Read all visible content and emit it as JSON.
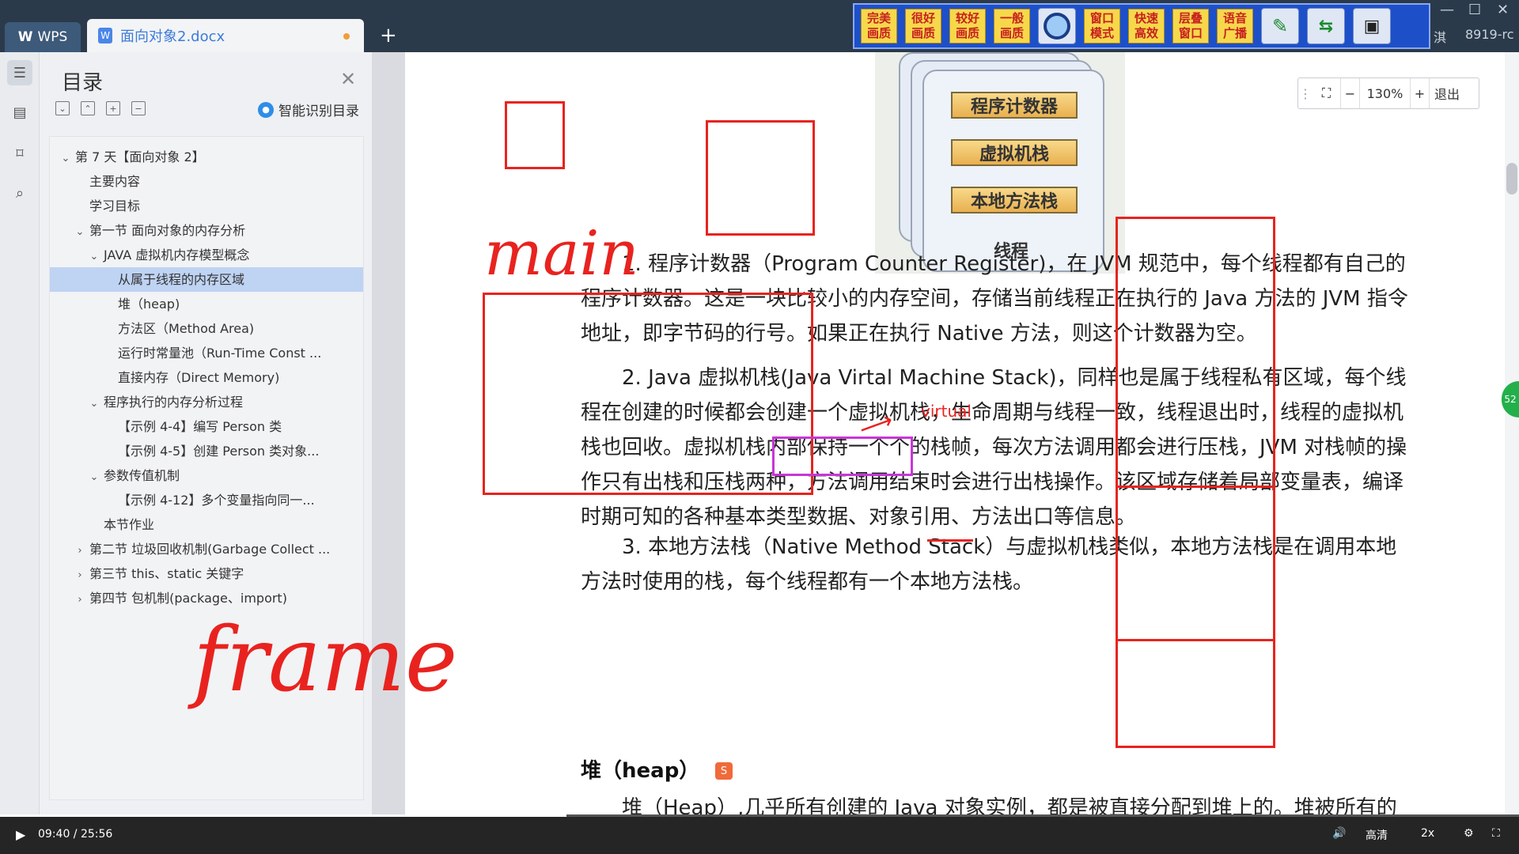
{
  "titlebar": {
    "wps_label": "WPS",
    "doc_tab_title": "面向对象2.docx",
    "new_tab_symbol": "+",
    "right_title": "8919-rc",
    "right_title_prefix": "淇"
  },
  "yellow_toolbar": {
    "buttons": [
      "完美画质",
      "很好画质",
      "较好画质",
      "一般画质",
      "窗口模式",
      "快速高效",
      "层叠窗口",
      "语音广播"
    ]
  },
  "toc": {
    "title": "目录",
    "smart_label": "智能识别目录",
    "items": [
      {
        "label": "第 7 天【面向对象 2】",
        "level": 0,
        "chevron": "v"
      },
      {
        "label": "主要内容",
        "level": 1,
        "chevron": ""
      },
      {
        "label": "学习目标",
        "level": 1,
        "chevron": ""
      },
      {
        "label": "第一节  面向对象的内存分析",
        "level": 1,
        "chevron": "v"
      },
      {
        "label": "JAVA 虚拟机内存模型概念",
        "level": 2,
        "chevron": "v"
      },
      {
        "label": "从属于线程的内存区域",
        "level": 3,
        "chevron": "",
        "selected": true
      },
      {
        "label": "堆（heap)",
        "level": 3,
        "chevron": ""
      },
      {
        "label": "方法区（Method Area)",
        "level": 3,
        "chevron": ""
      },
      {
        "label": "运行时常量池（Run-Time Const ...",
        "level": 3,
        "chevron": ""
      },
      {
        "label": "直接内存（Direct Memory)",
        "level": 3,
        "chevron": ""
      },
      {
        "label": "程序执行的内存分析过程",
        "level": 2,
        "chevron": "v"
      },
      {
        "label": "【示例 4-4】编写 Person 类",
        "level": 3,
        "chevron": ""
      },
      {
        "label": "【示例 4-5】创建 Person 类对象...",
        "level": 3,
        "chevron": ""
      },
      {
        "label": "参数传值机制",
        "level": 2,
        "chevron": "v"
      },
      {
        "label": "【示例 4-12】多个变量指向同一...",
        "level": 3,
        "chevron": ""
      },
      {
        "label": "本节作业",
        "level": 2,
        "chevron": ""
      },
      {
        "label": "第二节  垃圾回收机制(Garbage Collect ...",
        "level": 1,
        "chevron": ">"
      },
      {
        "label": "第三节  this、static 关键字",
        "level": 1,
        "chevron": ">"
      },
      {
        "label": "第四节  包机制(package、import)",
        "level": 1,
        "chevron": ">"
      }
    ]
  },
  "figure": {
    "labels": [
      "程序计数器",
      "虚拟机栈",
      "本地方法栈"
    ],
    "thread_label": "线程"
  },
  "zoom": {
    "value": "130%",
    "exit_label": "退出",
    "minus": "−",
    "plus": "+"
  },
  "document": {
    "para1": "1. 程序计数器（Program Counter Register)，在 JVM 规范中，每个线程都有自己的程序计数器。这是一块比较小的内存空间，存储当前线程正在执行的 Java 方法的 JVM 指令地址，即字节码的行号。如果正在执行 Native 方法，则这个计数器为空。",
    "para2": "2. Java 虚拟机栈(Java Virtal Machine Stack)，同样也是属于线程私有区域，每个线程在创建的时候都会创建一个虚拟机栈，生命周期与线程一致，线程退出时，线程的虚拟机栈也回收。虚拟机栈内部保持一个个的栈帧，每次方法调用都会进行压栈，JVM 对栈帧的操作只有出栈和压栈两种，方法调用结束时会进行出栈操作。该区域存储着局部变量表，编译时期可知的各种基本类型数据、对象引用、方法出口等信息。",
    "para3": "3. 本地方法栈（Native Method Stack）与虚拟机栈类似，本地方法栈是在调用本地方法时使用的栈，每个线程都有一个本地方法栈。",
    "heading": "堆（heap）",
    "para4": "堆（Heap）,几乎所有创建的 Java 对象实例，都是被直接分配到堆上的。堆被所有的"
  },
  "annotations": {
    "main_text": "main",
    "frame_text": "frame",
    "virtual_text": "virtual"
  },
  "side_badge": "52",
  "video": {
    "time": "09:40 / 25:56",
    "progress": 0.373,
    "quality": "高清",
    "speed": "2x"
  },
  "colors": {
    "annotation_red": "#e8231f",
    "annotation_magenta": "#c936d8",
    "toc_selected": "#bfd3f3",
    "titlebar": "#2b3a4a"
  }
}
